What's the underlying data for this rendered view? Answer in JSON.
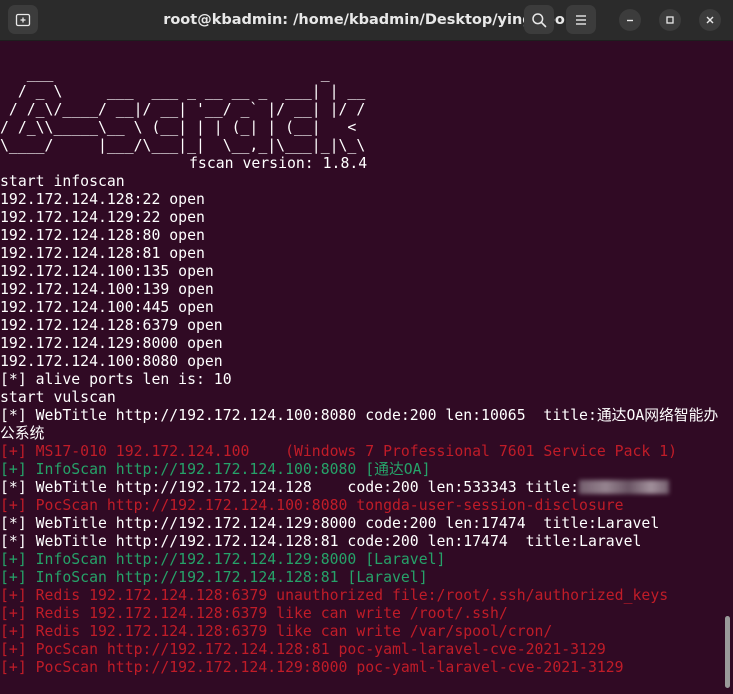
{
  "window": {
    "title": "root@kbadmin: /home/kbadmin/Desktop/ying/tool"
  },
  "icons": {
    "new_tab": "new-tab-icon",
    "search": "search-icon",
    "menu": "hamburger-menu-icon",
    "minimize": "minimize-icon",
    "maximize": "maximize-icon",
    "close": "close-icon"
  },
  "colors": {
    "background": "#300a24",
    "text": "#ffffff",
    "red": "#c01c28",
    "green": "#26a269",
    "titlebar": "#2b2b2b"
  },
  "terminal": {
    "banner": "   ___                              _    \n  / _ \\     ___  ___ _ __ __ _  ___| | __ \n / /_\\/____/ __|/ __| '__/ _` |/ __| |/ /\n/ /_\\\\_____\\__ \\ (__| | | (_| | (__|   <  \n\\____/     |___/\\___|_|  \\__,_|\\___|_|\\_\\ ",
    "version": "fscan version: 1.8.4",
    "lines": [
      "start infoscan",
      "192.172.124.128:22 open",
      "192.172.124.129:22 open",
      "192.172.124.128:80 open",
      "192.172.124.128:81 open",
      "192.172.124.100:135 open",
      "192.172.124.100:139 open",
      "192.172.124.100:445 open",
      "192.172.124.128:6379 open",
      "192.172.124.129:8000 open",
      "192.172.124.100:8080 open",
      "[*] alive ports len is: 10",
      "start vulscan"
    ],
    "webtitle_wrap": "[*] WebTitle http://192.172.124.100:8080 code:200 len:10065  title:通达OA网络智能办公系统",
    "results": [
      {
        "text": "[+] MS17-010 192.172.124.100    (Windows 7 Professional 7601 Service Pack 1)",
        "color": "red"
      },
      {
        "text": "[+] InfoScan http://192.172.124.100:8080 [通达OA]",
        "color": "green"
      },
      {
        "text": "[*] WebTitle http://192.172.124.128    code:200 len:533343 title:",
        "color": "white",
        "blurred": true
      },
      {
        "text": "[+] PocScan http://192.172.124.100:8080 tongda-user-session-disclosure",
        "color": "red"
      },
      {
        "text": "[*] WebTitle http://192.172.124.129:8000 code:200 len:17474  title:Laravel",
        "color": "white"
      },
      {
        "text": "[*] WebTitle http://192.172.124.128:81 code:200 len:17474  title:Laravel",
        "color": "white"
      },
      {
        "text": "[+] InfoScan http://192.172.124.129:8000 [Laravel]",
        "color": "green"
      },
      {
        "text": "[+] InfoScan http://192.172.124.128:81 [Laravel]",
        "color": "green"
      },
      {
        "text": "[+] Redis 192.172.124.128:6379 unauthorized file:/root/.ssh/authorized_keys",
        "color": "red"
      },
      {
        "text": "[+] Redis 192.172.124.128:6379 like can write /root/.ssh/",
        "color": "red"
      },
      {
        "text": "[+] Redis 192.172.124.128:6379 like can write /var/spool/cron/",
        "color": "red"
      },
      {
        "text": "[+] PocScan http://192.172.124.128:81 poc-yaml-laravel-cve-2021-3129",
        "color": "red"
      },
      {
        "text": "[+] PocScan http://192.172.124.129:8000 poc-yaml-laravel-cve-2021-3129",
        "color": "red"
      }
    ]
  }
}
